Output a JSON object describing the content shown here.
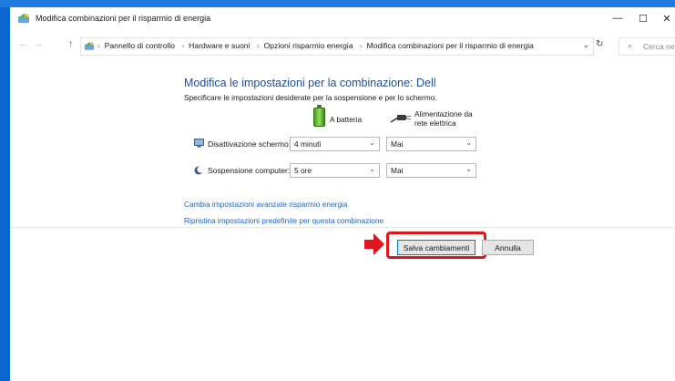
{
  "window": {
    "title": "Modifica combinazioni per il risparmio di energia",
    "controls": {
      "minimize": "—",
      "maximize": "☐",
      "close": "✕"
    }
  },
  "nav": {
    "back": "←",
    "forward": "→",
    "up": "↑"
  },
  "address": {
    "crumbs": [
      "Pannello di controllo",
      "Hardware e suoni",
      "Opzioni risparmio energia",
      "Modifica combinazioni per il risparmio di energia"
    ],
    "separator": "›",
    "dropdown": "⌄",
    "refresh": "↻"
  },
  "search": {
    "placeholder": "Cerca ne..."
  },
  "main": {
    "heading": "Modifica le impostazioni per la combinazione: Dell",
    "subheading": "Specificare le impostazioni desiderate per la sospensione e per lo schermo.",
    "columns": {
      "battery": "A batteria",
      "plugged_line1": "Alimentazione da",
      "plugged_line2": "rete elettrica"
    },
    "rows": [
      {
        "label": "Disattivazione schermo:",
        "battery_value": "4 minuti",
        "plugged_value": "Mai"
      },
      {
        "label": "Sospensione computer:",
        "battery_value": "5 ore",
        "plugged_value": "Mai"
      }
    ],
    "links": {
      "advanced": "Cambia impostazioni avanzate risparmio energia",
      "restore": "Ripristina impostazioni predefinite per questa combinazione"
    },
    "buttons": {
      "save": "Salva cambiamenti",
      "cancel": "Annulla"
    }
  },
  "colors": {
    "accent": "#0078d7",
    "link": "#1f64c6",
    "heading": "#1f4e9e",
    "annotation": "#e0141c"
  },
  "icons": [
    "control-panel-icon",
    "monitor-icon",
    "moon-icon",
    "battery-icon",
    "plug-icon",
    "search-icon",
    "refresh-icon"
  ]
}
